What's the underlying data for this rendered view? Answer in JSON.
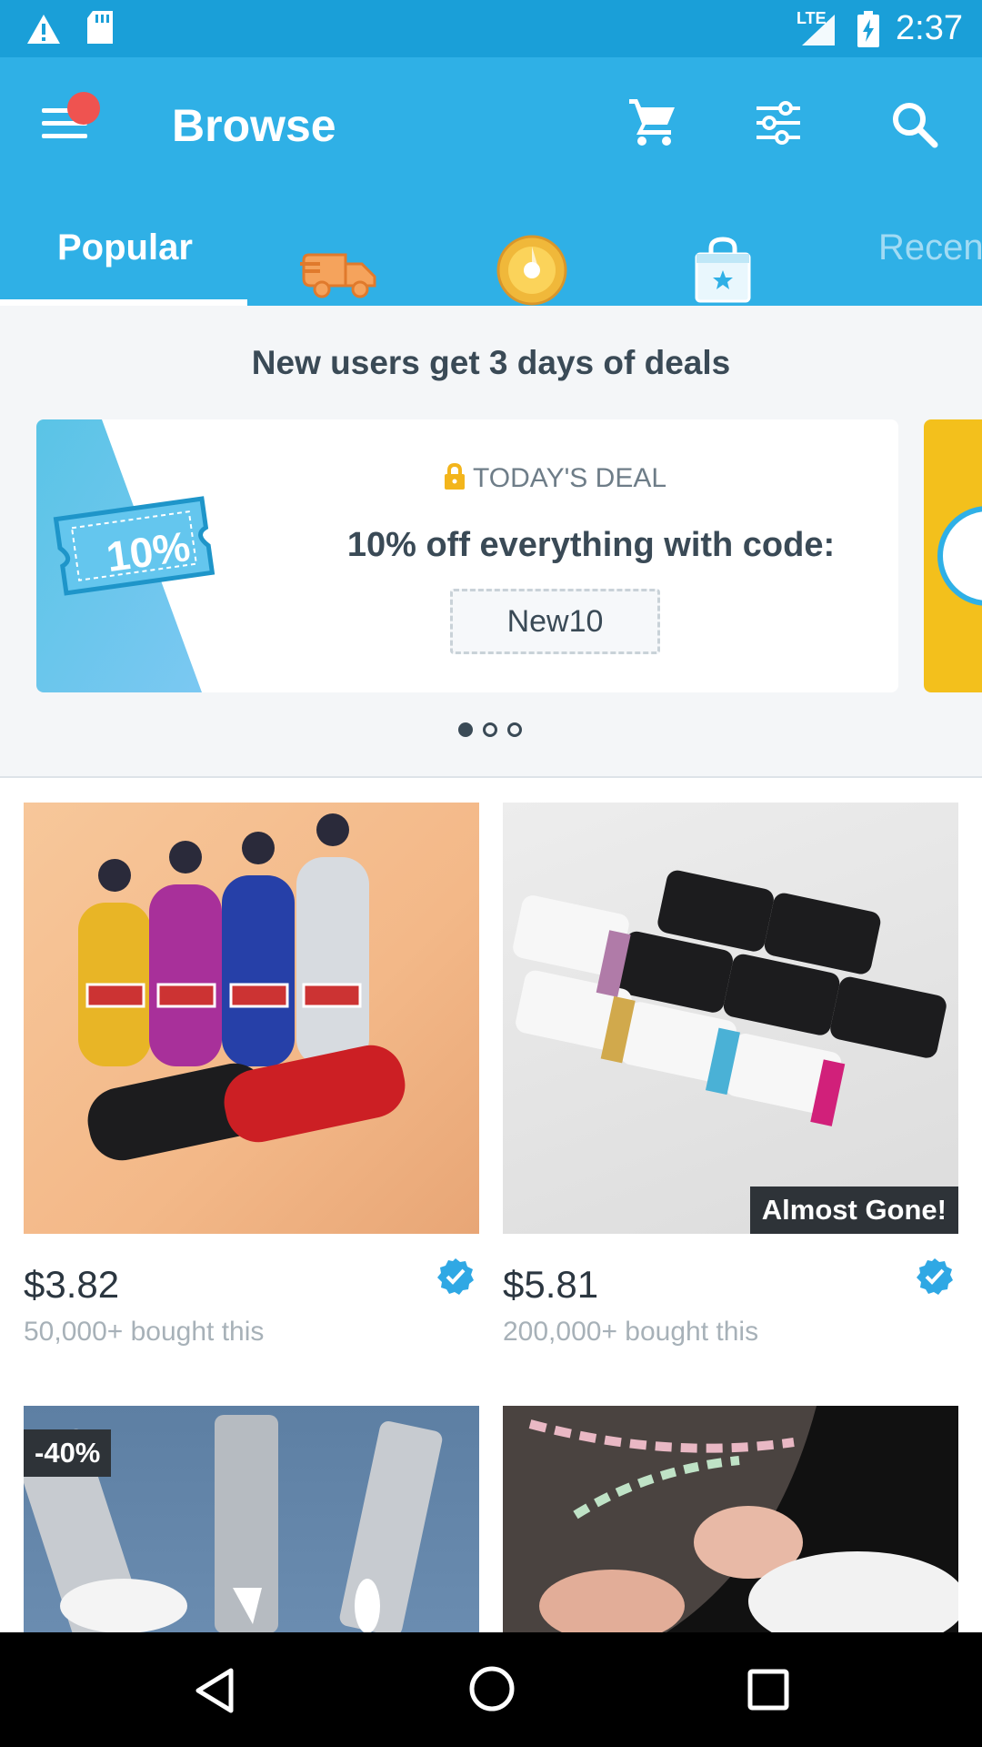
{
  "status_bar": {
    "network_label": "LTE",
    "time": "2:37"
  },
  "app_bar": {
    "title": "Browse",
    "icons": [
      "menu-icon",
      "cart-icon",
      "filter-icon",
      "search-icon"
    ]
  },
  "tabs": [
    {
      "label": "Popular",
      "selected": true
    },
    {
      "icon": "express-shipping-icon"
    },
    {
      "icon": "gift-disc-icon"
    },
    {
      "icon": "shopping-bag-star-icon"
    },
    {
      "label": "Recen"
    }
  ],
  "promo": {
    "heading": "New users get 3 days of deals",
    "card": {
      "coupon_text": "10%",
      "label": "TODAY'S DEAL",
      "text": "10% off everything with code:",
      "code": "New10"
    },
    "pager": {
      "count": 3,
      "active": 0
    }
  },
  "products": [
    {
      "price": "$3.82",
      "sold": "50,000+ bought this",
      "verified": true,
      "badge": ""
    },
    {
      "price": "$5.81",
      "sold": "200,000+ bought this",
      "verified": true,
      "badge": "Almost Gone!"
    },
    {
      "price": "",
      "sold": "",
      "verified": false,
      "badge": "-40%"
    },
    {
      "price": "",
      "sold": "",
      "verified": false,
      "badge": ""
    }
  ],
  "colors": {
    "primary": "#2fb0e6",
    "status_bar": "#1a9fd8",
    "notification_dot": "#ef5350",
    "deal_accent": "#f3c01c"
  }
}
